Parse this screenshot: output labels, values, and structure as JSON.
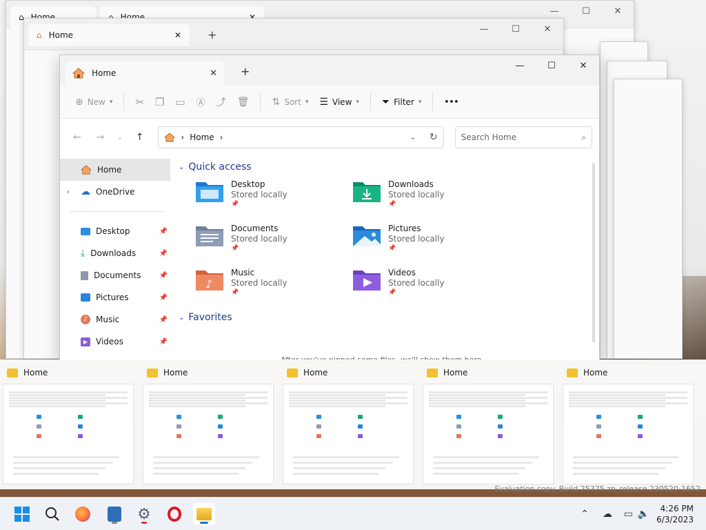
{
  "window": {
    "tab_title": "Home",
    "close_glyph": "✕",
    "new_tab_glyph": "+",
    "minimize_glyph": "—",
    "maximize_glyph": "☐",
    "window_close_glyph": "✕"
  },
  "background_windows": {
    "tab_title": "Home"
  },
  "toolbar": {
    "new_label": "New",
    "sort_label": "Sort",
    "view_label": "View",
    "filter_label": "Filter",
    "more_label": "•••"
  },
  "address": {
    "crumb": "Home",
    "sep": "›",
    "search_placeholder": "Search Home"
  },
  "nav": {
    "home": "Home",
    "onedrive": "OneDrive",
    "pinned": [
      "Desktop",
      "Downloads",
      "Documents",
      "Pictures",
      "Music",
      "Videos"
    ]
  },
  "quick_access": {
    "header": "Quick access",
    "items": [
      {
        "name": "Desktop",
        "status": "Stored locally"
      },
      {
        "name": "Downloads",
        "status": "Stored locally"
      },
      {
        "name": "Documents",
        "status": "Stored locally"
      },
      {
        "name": "Pictures",
        "status": "Stored locally"
      },
      {
        "name": "Music",
        "status": "Stored locally"
      },
      {
        "name": "Videos",
        "status": "Stored locally"
      }
    ]
  },
  "favorites": {
    "header": "Favorites",
    "hint": "After you've pinned some files, we'll show them here."
  },
  "alttab": {
    "titles": [
      "Home",
      "Home",
      "Home",
      "Home",
      "Home"
    ]
  },
  "watermark": "Evaluation copy. Build 25375.zn_release.230520-1652",
  "clock": {
    "time": "4:26 PM",
    "date": "6/3/2023"
  },
  "colors": {
    "accent": "#1f3a8f",
    "folder_blue": "#2b8fe0",
    "folder_green": "#19a97b",
    "folder_yellow": "#f2c230",
    "music": "#e07a5f",
    "videos": "#8b5cd6"
  }
}
